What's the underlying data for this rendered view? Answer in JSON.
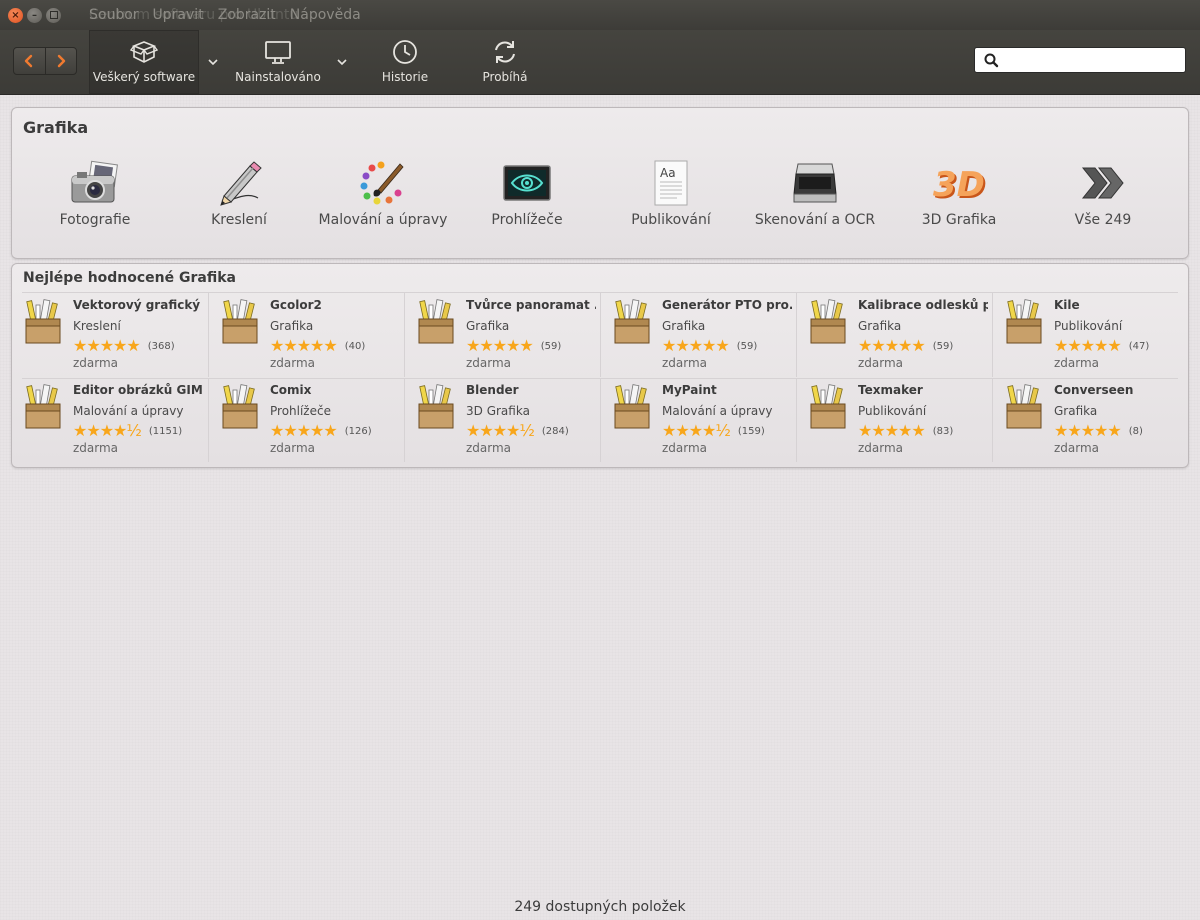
{
  "titlebar": {
    "ghost_title": "Centrum softwaru pro Ubuntu",
    "menu": [
      "Soubor",
      "Upravit",
      "Zobrazit",
      "Nápověda"
    ]
  },
  "toolbar": {
    "all_software": "Veškerý software",
    "installed": "Nainstalováno",
    "history": "Historie",
    "in_progress": "Probíhá",
    "search_placeholder": ""
  },
  "category_panel": {
    "title": "Grafika",
    "items": [
      {
        "label": "Fotografie",
        "icon": "camera-icon"
      },
      {
        "label": "Kreslení",
        "icon": "pencil-icon"
      },
      {
        "label": "Malování a úpravy",
        "icon": "palette-icon"
      },
      {
        "label": "Prohlížeče",
        "icon": "viewer-eye-icon"
      },
      {
        "label": "Publikování",
        "icon": "document-icon"
      },
      {
        "label": "Skenování a OCR",
        "icon": "scanner-icon"
      },
      {
        "label": "3D Grafika",
        "icon": "3d-icon"
      },
      {
        "label": "Vše 249",
        "icon": "double-chevron-icon"
      }
    ]
  },
  "top_rated": {
    "title": "Nejlépe hodnocené Grafika",
    "apps": [
      {
        "name": "Vektorový grafický ...",
        "category": "Kreslení",
        "stars": "★★★★★",
        "count": "(368)",
        "price": "zdarma"
      },
      {
        "name": "Gcolor2",
        "category": "Grafika",
        "stars": "★★★★★",
        "count": "(40)",
        "price": "zdarma"
      },
      {
        "name": "Tvůrce panoramat ...",
        "category": "Grafika",
        "stars": "★★★★★",
        "count": "(59)",
        "price": "zdarma"
      },
      {
        "name": "Generátor PTO pro...",
        "category": "Grafika",
        "stars": "★★★★★",
        "count": "(59)",
        "price": "zdarma"
      },
      {
        "name": "Kalibrace odlesků p...",
        "category": "Grafika",
        "stars": "★★★★★",
        "count": "(59)",
        "price": "zdarma"
      },
      {
        "name": "Kile",
        "category": "Publikování",
        "stars": "★★★★★",
        "count": "(47)",
        "price": "zdarma"
      },
      {
        "name": "Editor obrázků GIMP",
        "category": "Malování a úpravy",
        "stars": "★★★★½",
        "count": "(1151)",
        "price": "zdarma"
      },
      {
        "name": "Comix",
        "category": "Prohlížeče",
        "stars": "★★★★★",
        "count": "(126)",
        "price": "zdarma"
      },
      {
        "name": "Blender",
        "category": "3D Grafika",
        "stars": "★★★★½",
        "count": "(284)",
        "price": "zdarma"
      },
      {
        "name": "MyPaint",
        "category": "Malování a úpravy",
        "stars": "★★★★½",
        "count": "(159)",
        "price": "zdarma"
      },
      {
        "name": "Texmaker",
        "category": "Publikování",
        "stars": "★★★★★",
        "count": "(83)",
        "price": "zdarma"
      },
      {
        "name": "Converseen",
        "category": "Grafika",
        "stars": "★★★★★",
        "count": "(8)",
        "price": "zdarma"
      }
    ]
  },
  "statusbar": {
    "text": "249 dostupných položek"
  },
  "colors": {
    "accent_orange": "#f07a30",
    "star": "#f8a61b",
    "toolbar": "#3c3b37"
  }
}
